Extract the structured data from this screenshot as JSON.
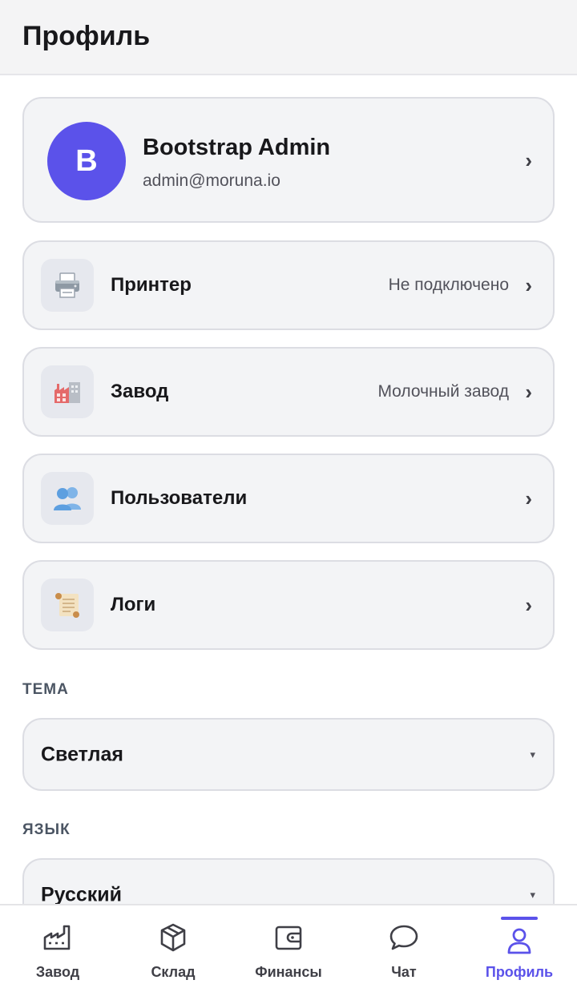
{
  "header": {
    "title": "Профиль"
  },
  "profile": {
    "avatar_letter": "B",
    "name": "Bootstrap Admin",
    "email": "admin@moruna.io"
  },
  "menu": [
    {
      "label": "Принтер",
      "value": "Не подключено",
      "icon": "printer-icon"
    },
    {
      "label": "Завод",
      "value": "Молочный завод",
      "icon": "factory-icon"
    },
    {
      "label": "Пользователи",
      "value": "",
      "icon": "users-icon"
    },
    {
      "label": "Логи",
      "value": "",
      "icon": "scroll-icon"
    }
  ],
  "theme": {
    "section_label": "ТЕМА",
    "value": "Светлая"
  },
  "language": {
    "section_label": "ЯЗЫК",
    "value": "Русский"
  },
  "chevron": "›",
  "caret": "▾",
  "tabs": [
    {
      "label": "Завод",
      "icon": "factory-icon",
      "active": false
    },
    {
      "label": "Склад",
      "icon": "box-icon",
      "active": false
    },
    {
      "label": "Финансы",
      "icon": "wallet-icon",
      "active": false
    },
    {
      "label": "Чат",
      "icon": "chat-icon",
      "active": false
    },
    {
      "label": "Профиль",
      "icon": "user-icon",
      "active": true
    }
  ],
  "colors": {
    "accent": "#5b52ea",
    "card_bg": "#f3f4f6",
    "header_bg": "#f4f4f5"
  }
}
